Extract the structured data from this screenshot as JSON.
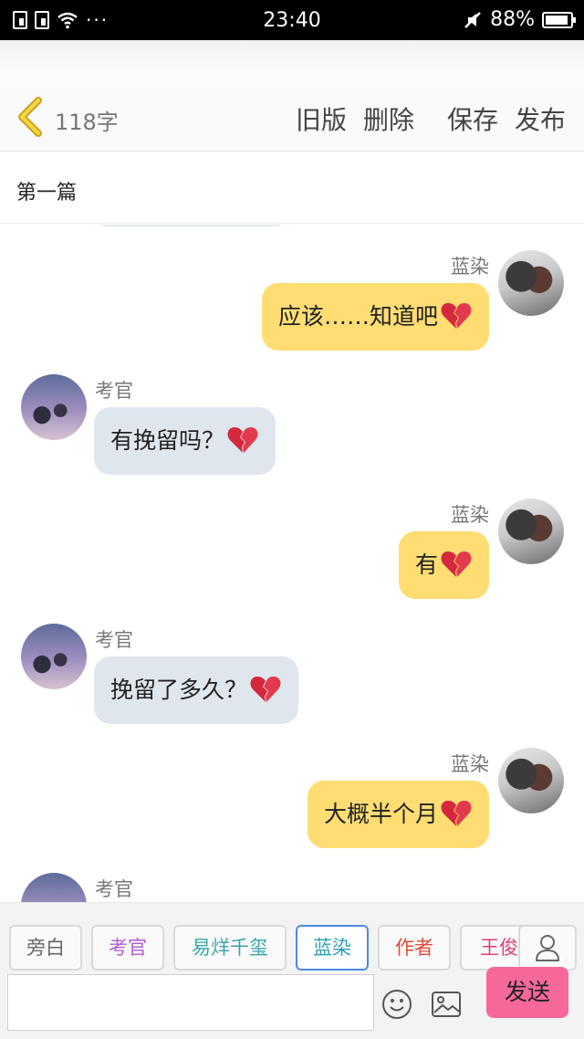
{
  "status_bar": {
    "time": "23:40",
    "battery": "88%",
    "more": "···"
  },
  "toolbar": {
    "word_count": "118字",
    "old_version": "旧版",
    "delete": "删除",
    "save": "保存",
    "publish": "发布"
  },
  "title": "第一篇",
  "messages": [
    {
      "sender": "蓝染",
      "text": "应该……知道吧",
      "side": "right",
      "icon": "broken-heart-icon"
    },
    {
      "sender": "考官",
      "text": "有挽留吗？",
      "side": "left",
      "icon": "broken-heart-icon"
    },
    {
      "sender": "蓝染",
      "text": "有",
      "side": "right",
      "icon": "broken-heart-icon"
    },
    {
      "sender": "考官",
      "text": "挽留了多久？",
      "side": "left",
      "icon": "broken-heart-icon"
    },
    {
      "sender": "蓝染",
      "text": "大概半个月",
      "side": "right",
      "icon": "broken-heart-icon"
    },
    {
      "sender": "考官",
      "text": "",
      "side": "left"
    }
  ],
  "roles": [
    {
      "label": "旁白",
      "color": "#666666"
    },
    {
      "label": "考官",
      "color": "#b35ad0"
    },
    {
      "label": "易烊千玺",
      "color": "#3aa6a6"
    },
    {
      "label": "蓝染",
      "color": "#2f9fb0"
    },
    {
      "label": "作者",
      "color": "#e04a3a"
    },
    {
      "label": "王俊",
      "color": "#e0407a"
    }
  ],
  "composer": {
    "input_value": "",
    "send": "发送"
  },
  "colors": {
    "self_bubble": "#ffdd73",
    "other_bubble": "#dfe6ee",
    "send_button": "#f6679a",
    "active_role_border": "#4b8ae0"
  }
}
